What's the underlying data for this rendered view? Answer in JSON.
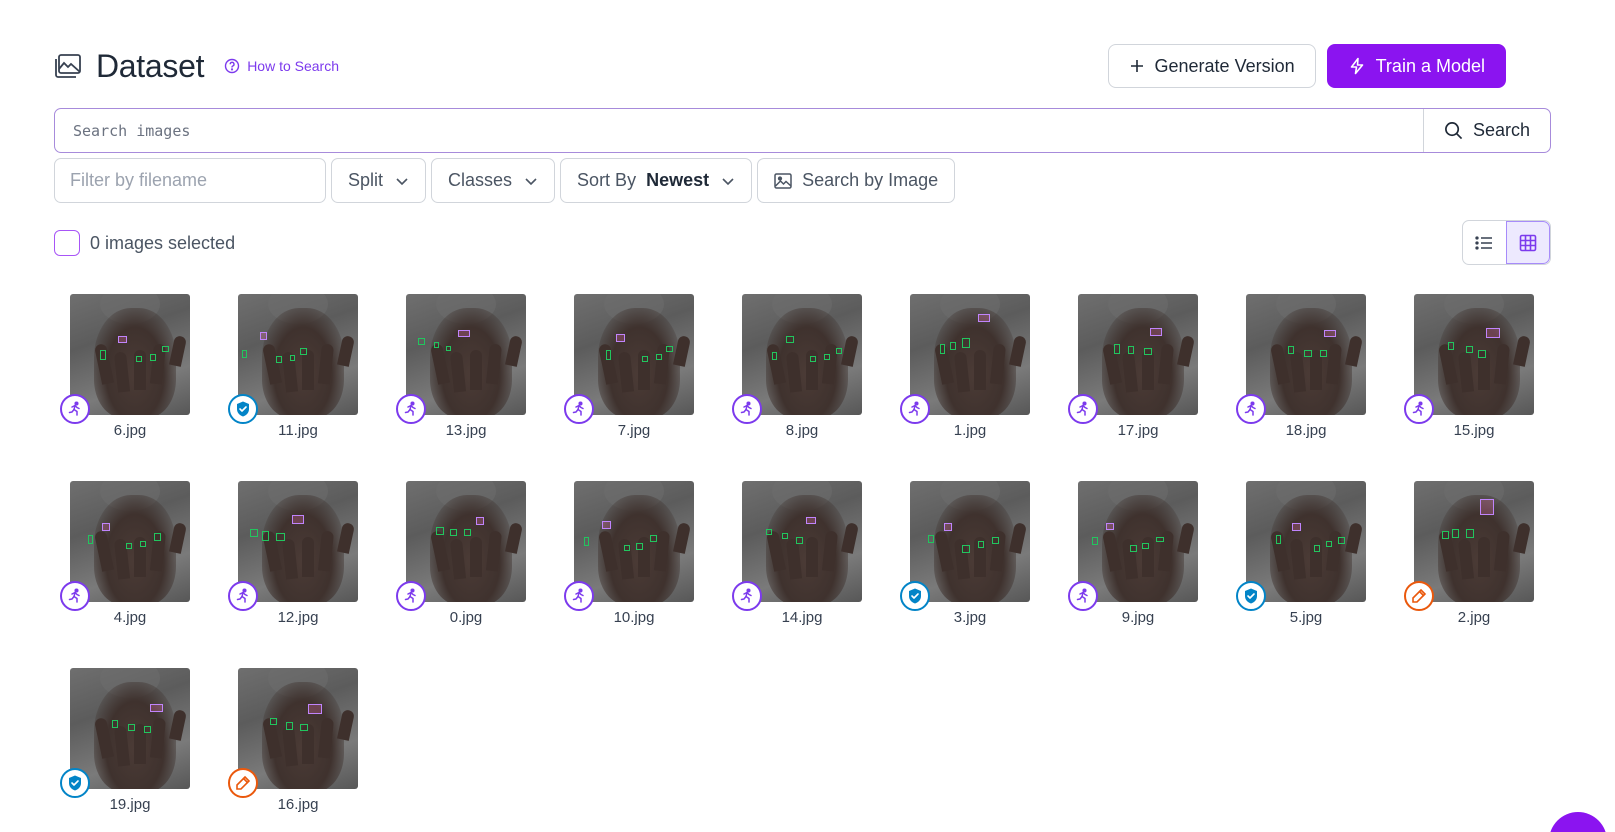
{
  "header": {
    "title": "Dataset",
    "how_to_search": "How to Search",
    "generate_version": "Generate Version",
    "train_model": "Train a Model"
  },
  "search": {
    "placeholder": "Search images",
    "button": "Search"
  },
  "filters": {
    "filename_placeholder": "Filter by filename",
    "split": "Split",
    "classes": "Classes",
    "sort_by": "Sort By",
    "sort_value": "Newest",
    "search_by_image": "Search by Image"
  },
  "selection": {
    "count_text": "0 images selected"
  },
  "colors": {
    "accent": "#8b14f0",
    "train_badge": "#7c3aed",
    "valid_badge": "#0284c7",
    "test_badge": "#ea580c",
    "box_green": "#22c55e",
    "box_pink": "#c084fc"
  },
  "images": [
    {
      "name": "6.jpg",
      "split": "train"
    },
    {
      "name": "11.jpg",
      "split": "valid"
    },
    {
      "name": "13.jpg",
      "split": "train"
    },
    {
      "name": "7.jpg",
      "split": "train"
    },
    {
      "name": "8.jpg",
      "split": "train"
    },
    {
      "name": "1.jpg",
      "split": "train"
    },
    {
      "name": "17.jpg",
      "split": "train"
    },
    {
      "name": "18.jpg",
      "split": "train"
    },
    {
      "name": "15.jpg",
      "split": "train"
    },
    {
      "name": "4.jpg",
      "split": "train"
    },
    {
      "name": "12.jpg",
      "split": "train"
    },
    {
      "name": "0.jpg",
      "split": "train"
    },
    {
      "name": "10.jpg",
      "split": "train"
    },
    {
      "name": "14.jpg",
      "split": "train"
    },
    {
      "name": "3.jpg",
      "split": "valid"
    },
    {
      "name": "9.jpg",
      "split": "train"
    },
    {
      "name": "5.jpg",
      "split": "valid"
    },
    {
      "name": "2.jpg",
      "split": "test"
    },
    {
      "name": "19.jpg",
      "split": "valid"
    },
    {
      "name": "16.jpg",
      "split": "test"
    }
  ]
}
